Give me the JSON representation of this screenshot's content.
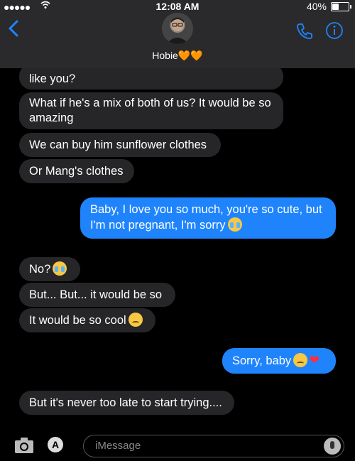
{
  "status": {
    "time": "12:08 AM",
    "battery": "40%"
  },
  "contact": {
    "name": "Hobie🧡🧡"
  },
  "colors": {
    "incoming_bubble": "#262628",
    "outgoing_bubble": "#1f84fc",
    "header_bg": "#2a2a2c",
    "accent": "#1f84fc"
  },
  "messages": [
    {
      "from": "them",
      "text": "like you?"
    },
    {
      "from": "them",
      "text": "What if he's a mix of both of us? It would be so"
    },
    {
      "from": "them",
      "text": "amazing"
    },
    {
      "from": "them",
      "text": "We can buy him sunflower clothes"
    },
    {
      "from": "them",
      "text": "Or Mang's clothes"
    },
    {
      "from": "me",
      "text": "Baby, I love you so much, you're so cute, but"
    },
    {
      "from": "me",
      "text": "I'm not pregnant, I'm sorry"
    },
    {
      "from": "them",
      "text": "No?"
    },
    {
      "from": "them",
      "text": "But... But... it would be so"
    },
    {
      "from": "them",
      "text": "It would be so cool"
    },
    {
      "from": "me",
      "text": "Sorry, baby"
    },
    {
      "from": "them",
      "text": "But it's never too late to start trying...."
    }
  ],
  "composer": {
    "placeholder": "iMessage"
  },
  "icons": [
    "back-chevron-icon",
    "phone-icon",
    "info-icon",
    "camera-icon",
    "appstore-icon",
    "microphone-icon",
    "crying-emoji-icon",
    "sad-emoji-icon",
    "heart-icon"
  ]
}
